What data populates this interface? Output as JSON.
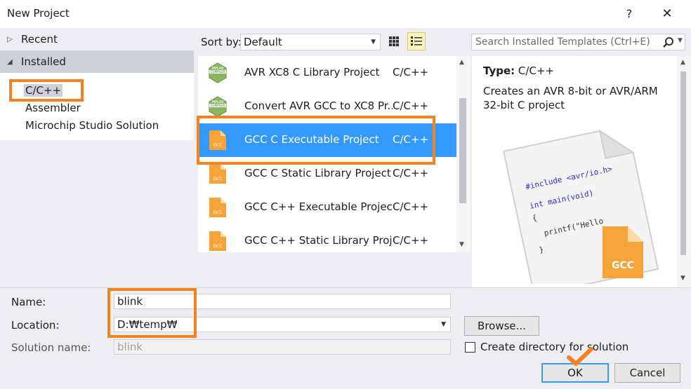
{
  "dialog": {
    "title": "New Project",
    "help": "?",
    "close": "✕"
  },
  "tree": {
    "recent": "Recent",
    "installed": "Installed",
    "items": [
      "C/C++",
      "Assembler",
      "Microchip Studio Solution"
    ]
  },
  "sort": {
    "label": "Sort by:",
    "value": "Default"
  },
  "search": {
    "placeholder": "Search Installed Templates (Ctrl+E)"
  },
  "templates": [
    {
      "name": "AVR XC8 C Library Project",
      "lang": "C/C++",
      "icon": "mplab-compiler-icon"
    },
    {
      "name": "Convert AVR GCC to XC8 Pr...",
      "lang": "C/C++",
      "icon": "mplab-compiler-icon"
    },
    {
      "name": "GCC C Executable Project",
      "lang": "C/C++",
      "icon": "gcc-file-icon"
    },
    {
      "name": "GCC C Static Library Project",
      "lang": "C/C++",
      "icon": "gcc-file-icon"
    },
    {
      "name": "GCC C++ Executable Project",
      "lang": "C/C++",
      "icon": "gcc-file-icon"
    },
    {
      "name": "GCC C++ Static Library Project",
      "lang": "C/C++",
      "icon": "gcc-file-icon"
    }
  ],
  "details": {
    "type_label": "Type:",
    "type_value": "C/C++",
    "description": "Creates an AVR 8-bit or AVR/ARM 32-bit C project",
    "code_lines": [
      "#include <avr/io.h>",
      "int main(void)",
      "{",
      "printf(\"Hello",
      "}"
    ],
    "badge": "GCC"
  },
  "form": {
    "name_label": "Name:",
    "name_value": "blink",
    "location_label": "Location:",
    "location_value": "D:₩temp₩",
    "solution_label": "Solution name:",
    "solution_value": "blink",
    "browse": "Browse...",
    "create_dir": "Create directory for solution",
    "ok": "OK",
    "cancel": "Cancel"
  },
  "colors": {
    "selection": "#3399ff",
    "highlight": "#f58220",
    "gcc_orange": "#f5a33b"
  }
}
